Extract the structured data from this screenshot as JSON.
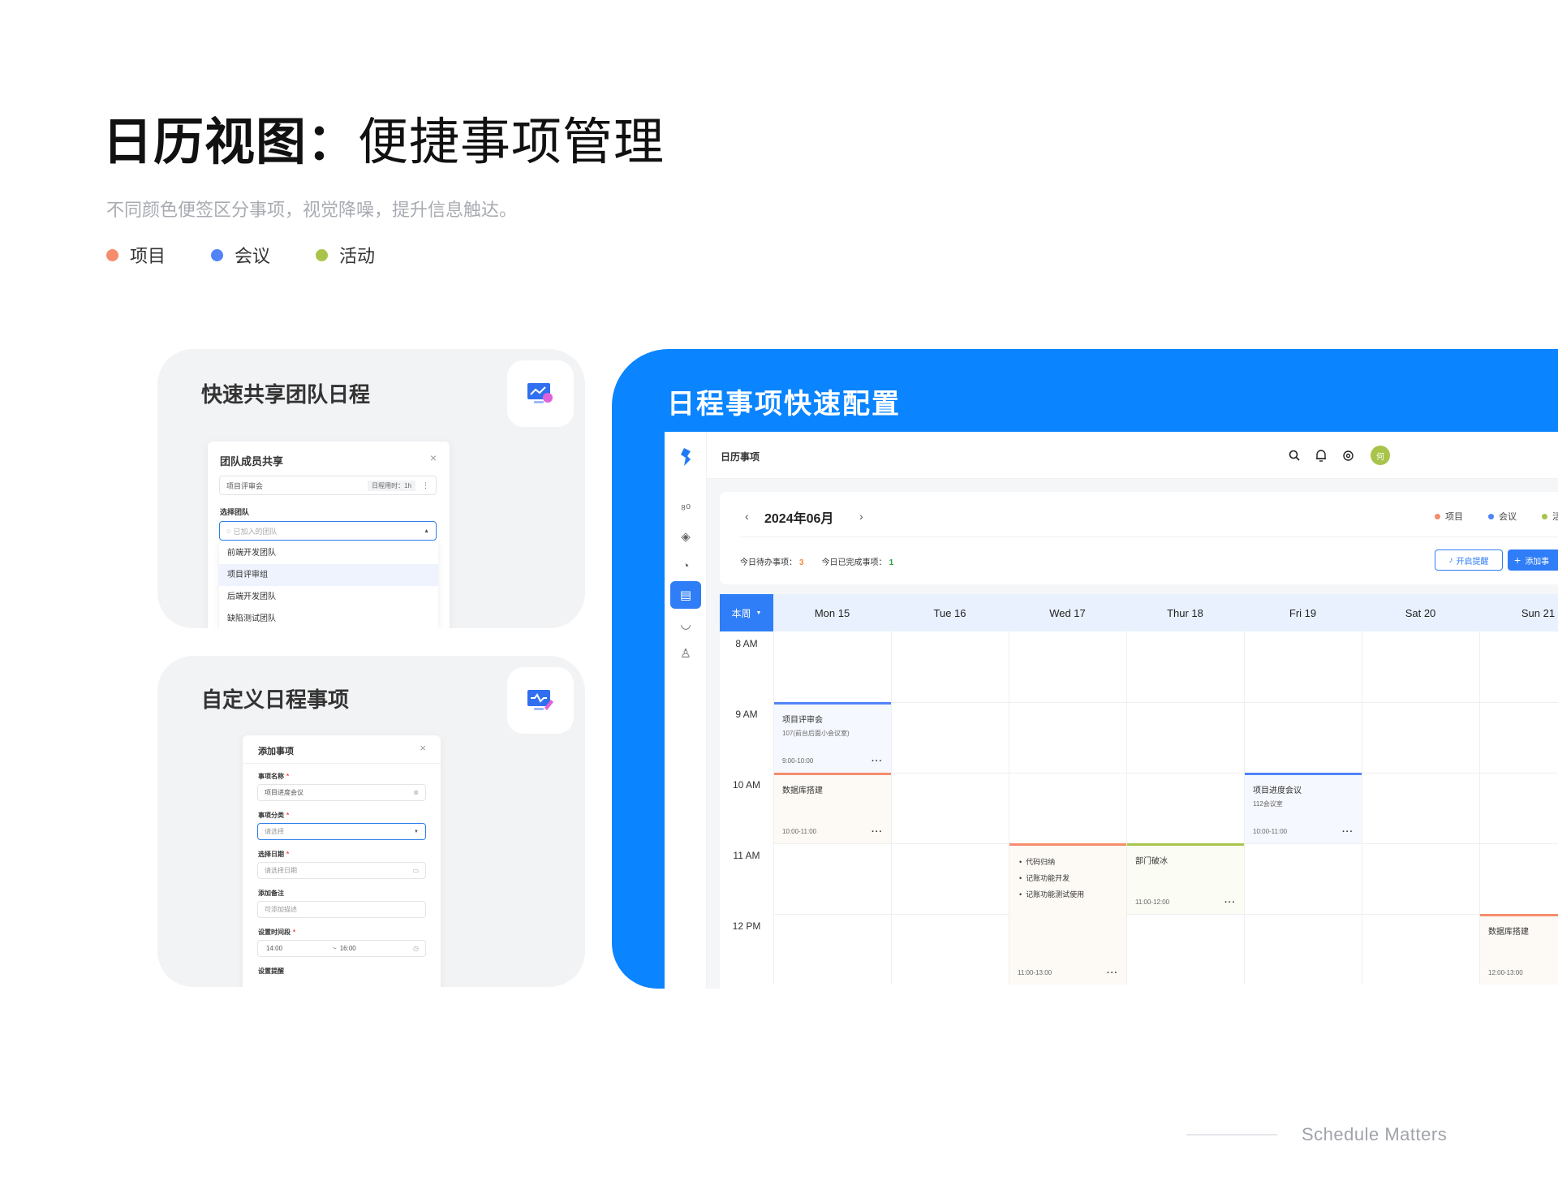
{
  "header": {
    "title_bold": "日历视图：",
    "title_regular": "便捷事项管理",
    "subtitle": "不同颜色便签区分事项，视觉降噪，提升信息触达。",
    "legend": [
      {
        "label": "项目",
        "color": "#f58c6c"
      },
      {
        "label": "会议",
        "color": "#5283f7"
      },
      {
        "label": "活动",
        "color": "#a8c44a"
      }
    ]
  },
  "card_share": {
    "title": "快速共享团队日程",
    "icon": "share-calendar-icon",
    "dialog": {
      "title": "团队成员共享",
      "event_value": "项目评审会",
      "duration_label": "日程用时：1h",
      "select_label": "选择团队",
      "search_placeholder": "已加入的团队",
      "options": [
        "前端开发团队",
        "项目评审组",
        "后端开发团队",
        "缺陷测试团队"
      ],
      "selected_index": 1
    }
  },
  "card_custom": {
    "title": "自定义日程事项",
    "icon": "edit-calendar-icon",
    "dialog": {
      "title": "添加事项",
      "name_label": "事项名称",
      "name_value": "项目进度会议",
      "type_label": "事项分类",
      "type_placeholder": "请选择",
      "date_label": "选择日期",
      "date_placeholder": "请选择日期",
      "note_label": "添加备注",
      "note_placeholder": "可添加描述",
      "time_label": "设置时间段",
      "time_start": "14:00",
      "time_sep": "~",
      "time_end": "16:00",
      "remind_label": "设置提醒"
    }
  },
  "panel": {
    "title": "日程事项快速配置",
    "accent": "#0a84ff",
    "app": {
      "name": "日历事项",
      "avatar": "何",
      "avatar_color": "#a8c44a",
      "month": "2024年06月",
      "prev": "‹",
      "next": "›",
      "legend": [
        {
          "label": "项目",
          "color": "#f58c6c"
        },
        {
          "label": "会议",
          "color": "#5283f7"
        },
        {
          "label": "活",
          "color": "#a8c44a"
        }
      ],
      "stats": {
        "todo_label": "今日待办事项：",
        "todo_value": "3",
        "done_label": "今日已完成事项：",
        "done_value": "1"
      },
      "remind_button": "开启提醒",
      "add_button": "添加事",
      "week_button": "本周",
      "days": [
        "Mon 15",
        "Tue 16",
        "Wed 17",
        "Thur 18",
        "Fri 19",
        "Sat 20",
        "Sun 21"
      ],
      "times": [
        "8 AM",
        "9 AM",
        "10 AM",
        "11 AM",
        "12 PM"
      ],
      "events": [
        {
          "day": 0,
          "start": 9,
          "end": 10,
          "kind": "meeting",
          "name": "项目评审会",
          "location": "107(前台后面小会议室)",
          "time": "9:00-10:00",
          "more": "···"
        },
        {
          "day": 0,
          "start": 10,
          "end": 11,
          "kind": "project",
          "name": "数据库搭建",
          "location": "",
          "time": "10:00-11:00",
          "more": "···"
        },
        {
          "day": 4,
          "start": 10,
          "end": 11,
          "kind": "meeting",
          "name": "项目进度会议",
          "location": "112会议室",
          "time": "10:00-11:00",
          "more": "···"
        },
        {
          "day": 2,
          "start": 11,
          "end": 13,
          "kind": "project",
          "items": [
            "代码归纳",
            "记账功能开发",
            "记账功能测试使用"
          ],
          "time": "11:00-13:00",
          "more": "···"
        },
        {
          "day": 3,
          "start": 11,
          "end": 12,
          "kind": "activity",
          "name": "部门破冰",
          "location": "",
          "time": "11:00-12:00",
          "more": "···"
        },
        {
          "day": 6,
          "start": 12,
          "end": 13,
          "kind": "project",
          "name": "数据库搭建",
          "location": "",
          "time": "12:00-13:00",
          "more": "···"
        }
      ],
      "kind_colors": {
        "project": {
          "line": "#f58c6c",
          "bg": "#fdfaf5"
        },
        "meeting": {
          "line": "#5283f7",
          "bg": "#f5f8fe"
        },
        "activity": {
          "line": "#a8c44a",
          "bg": "#fbfcf4"
        }
      }
    }
  },
  "footer": {
    "text": "Schedule Matters"
  }
}
